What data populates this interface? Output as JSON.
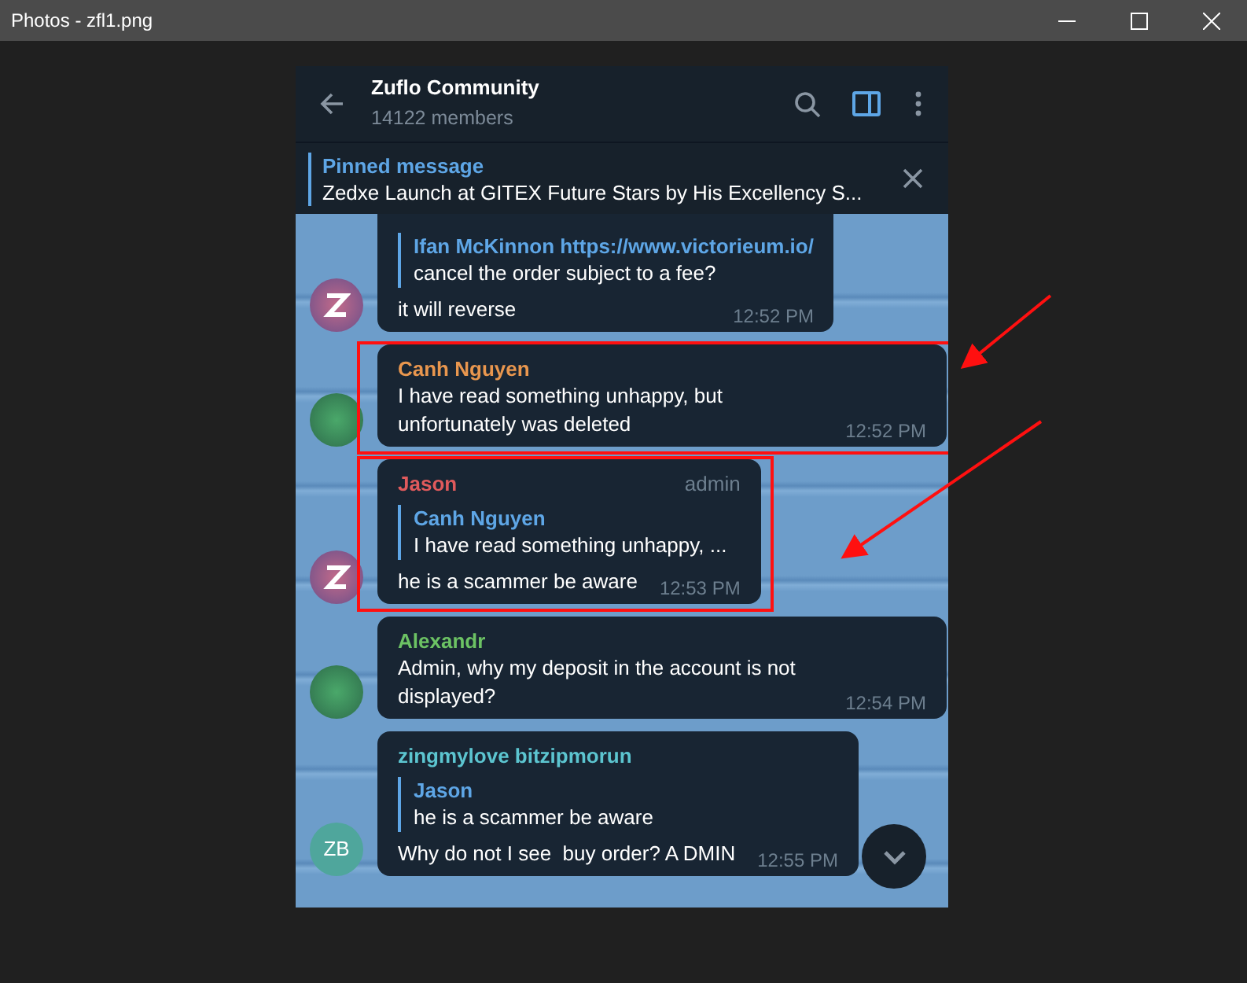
{
  "window": {
    "title": "Photos - zfl1.png"
  },
  "chat": {
    "title": "Zuflo Community",
    "subtitle": "14122 members"
  },
  "pinned": {
    "label": "Pinned message",
    "text": "Zedxe Launch at GITEX Future Stars by His Excellency S..."
  },
  "messages": [
    {
      "avatar": {
        "kind": "logo"
      },
      "reply": {
        "author": "Ifan McKinnon https://www.victorieum.io/",
        "text": "cancel the order subject to a fee?"
      },
      "text": "it will reverse",
      "time": "12:52 PM"
    },
    {
      "avatar": {
        "kind": "photo"
      },
      "sender": "Canh Nguyen",
      "color": "#e8964e",
      "text": "I have read something unhappy, but unfortunately was deleted",
      "time": "12:52 PM",
      "highlighted": true
    },
    {
      "avatar": {
        "kind": "logo"
      },
      "sender": "Jason",
      "color": "#e05a5c",
      "role": "admin",
      "reply": {
        "author": "Canh Nguyen",
        "text": "I have read something unhappy, ..."
      },
      "text": "he is a scammer be aware",
      "time": "12:53 PM",
      "highlighted": true
    },
    {
      "avatar": {
        "kind": "photo"
      },
      "sender": "Alexandr",
      "color": "#6cc264",
      "text": "Admin, why my deposit in the account is not displayed?",
      "time": "12:54 PM"
    },
    {
      "avatar": {
        "kind": "initials",
        "initials": "ZB"
      },
      "sender": "zingmylove bitzipmorun",
      "color": "#5cc5d0",
      "reply": {
        "author": "Jason",
        "text": "he is a scammer be aware"
      },
      "text": "Why do not I see  buy order? A DMIN",
      "time": "12:55 PM"
    }
  ]
}
